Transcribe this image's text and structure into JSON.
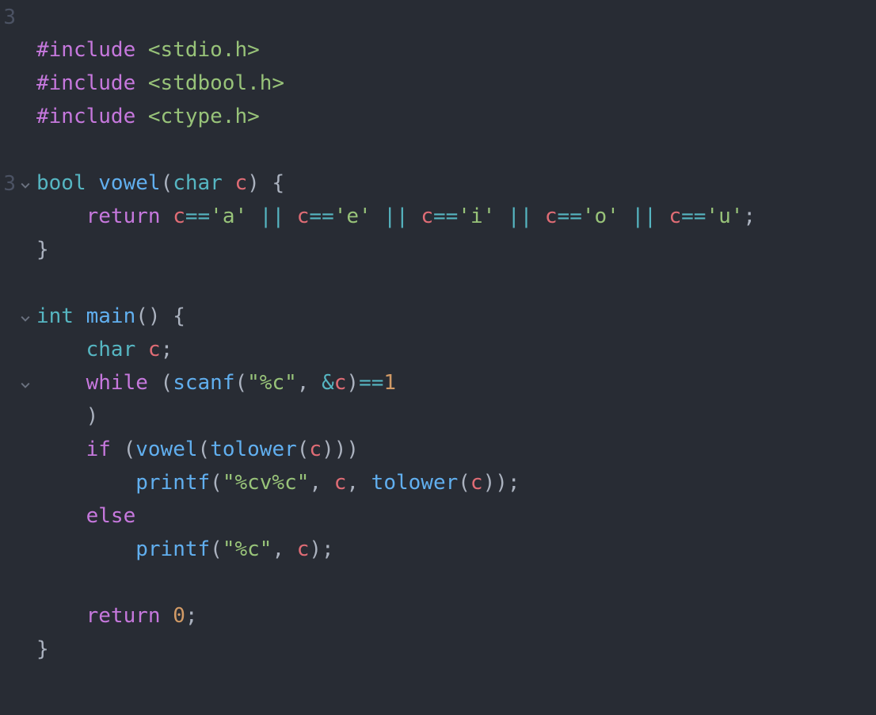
{
  "gutter": {
    "rows": [
      {
        "n": "3",
        "fold": false
      },
      {
        "n": " ",
        "fold": false
      },
      {
        "n": " ",
        "fold": false
      },
      {
        "n": " ",
        "fold": false
      },
      {
        "n": " ",
        "fold": false
      },
      {
        "n": "3",
        "fold": true
      },
      {
        "n": " ",
        "fold": false
      },
      {
        "n": " ",
        "fold": false
      },
      {
        "n": " ",
        "fold": false
      },
      {
        "n": " ",
        "fold": true
      },
      {
        "n": " ",
        "fold": false
      },
      {
        "n": " ",
        "fold": true
      },
      {
        "n": " ",
        "fold": false
      },
      {
        "n": " ",
        "fold": false
      },
      {
        "n": " ",
        "fold": false
      },
      {
        "n": " ",
        "fold": false
      },
      {
        "n": " ",
        "fold": false
      },
      {
        "n": " ",
        "fold": false
      },
      {
        "n": " ",
        "fold": false
      },
      {
        "n": " ",
        "fold": false
      },
      {
        "n": " ",
        "fold": false
      }
    ]
  },
  "code": {
    "lines": [
      [],
      [
        {
          "t": "#include ",
          "c": "pp"
        },
        {
          "t": "<stdio.h>",
          "c": "inc"
        }
      ],
      [
        {
          "t": "#include ",
          "c": "pp"
        },
        {
          "t": "<stdbool.h>",
          "c": "inc"
        }
      ],
      [
        {
          "t": "#include ",
          "c": "pp"
        },
        {
          "t": "<ctype.h>",
          "c": "inc"
        }
      ],
      [],
      [
        {
          "t": "bool",
          "c": "ty2"
        },
        {
          "t": " ",
          "c": "pun"
        },
        {
          "t": "vowel",
          "c": "fn"
        },
        {
          "t": "(",
          "c": "pun"
        },
        {
          "t": "char",
          "c": "ty2"
        },
        {
          "t": " ",
          "c": "pun"
        },
        {
          "t": "c",
          "c": "var2"
        },
        {
          "t": ") {",
          "c": "pun"
        }
      ],
      [
        {
          "t": "    ",
          "c": "pun"
        },
        {
          "t": "return",
          "c": "kw"
        },
        {
          "t": " ",
          "c": "pun"
        },
        {
          "t": "c",
          "c": "var2"
        },
        {
          "t": "==",
          "c": "op"
        },
        {
          "t": "'a'",
          "c": "str"
        },
        {
          "t": " ",
          "c": "pun"
        },
        {
          "t": "||",
          "c": "op"
        },
        {
          "t": " ",
          "c": "pun"
        },
        {
          "t": "c",
          "c": "var2"
        },
        {
          "t": "==",
          "c": "op"
        },
        {
          "t": "'e'",
          "c": "str"
        },
        {
          "t": " ",
          "c": "pun"
        },
        {
          "t": "||",
          "c": "op"
        },
        {
          "t": " ",
          "c": "pun"
        },
        {
          "t": "c",
          "c": "var2"
        },
        {
          "t": "==",
          "c": "op"
        },
        {
          "t": "'i'",
          "c": "str"
        },
        {
          "t": " ",
          "c": "pun"
        },
        {
          "t": "||",
          "c": "op"
        },
        {
          "t": " ",
          "c": "pun"
        },
        {
          "t": "c",
          "c": "var2"
        },
        {
          "t": "==",
          "c": "op"
        },
        {
          "t": "'o'",
          "c": "str"
        },
        {
          "t": " ",
          "c": "pun"
        },
        {
          "t": "||",
          "c": "op"
        },
        {
          "t": " ",
          "c": "pun"
        },
        {
          "t": "c",
          "c": "var2"
        },
        {
          "t": "==",
          "c": "op"
        },
        {
          "t": "'u'",
          "c": "str"
        },
        {
          "t": ";",
          "c": "pun"
        }
      ],
      [
        {
          "t": "}",
          "c": "pun"
        }
      ],
      [],
      [
        {
          "t": "int",
          "c": "ty2"
        },
        {
          "t": " ",
          "c": "pun"
        },
        {
          "t": "main",
          "c": "fn"
        },
        {
          "t": "() {",
          "c": "pun"
        }
      ],
      [
        {
          "t": "    ",
          "c": "pun"
        },
        {
          "t": "char",
          "c": "ty2"
        },
        {
          "t": " ",
          "c": "pun"
        },
        {
          "t": "c",
          "c": "var2"
        },
        {
          "t": ";",
          "c": "pun"
        }
      ],
      [
        {
          "t": "    ",
          "c": "pun"
        },
        {
          "t": "while",
          "c": "kw"
        },
        {
          "t": " (",
          "c": "pun"
        },
        {
          "t": "scanf",
          "c": "fn"
        },
        {
          "t": "(",
          "c": "pun"
        },
        {
          "t": "\"%c\"",
          "c": "str"
        },
        {
          "t": ", ",
          "c": "pun"
        },
        {
          "t": "&",
          "c": "op"
        },
        {
          "t": "c",
          "c": "var2"
        },
        {
          "t": ")",
          "c": "pun"
        },
        {
          "t": "==",
          "c": "op"
        },
        {
          "t": "1",
          "c": "num"
        }
      ],
      [
        {
          "t": "    )",
          "c": "pun"
        }
      ],
      [
        {
          "t": "    ",
          "c": "pun"
        },
        {
          "t": "if",
          "c": "kw"
        },
        {
          "t": " (",
          "c": "pun"
        },
        {
          "t": "vowel",
          "c": "fn"
        },
        {
          "t": "(",
          "c": "pun"
        },
        {
          "t": "tolower",
          "c": "fn"
        },
        {
          "t": "(",
          "c": "pun"
        },
        {
          "t": "c",
          "c": "var2"
        },
        {
          "t": ")))",
          "c": "pun"
        }
      ],
      [
        {
          "t": "        ",
          "c": "pun"
        },
        {
          "t": "printf",
          "c": "fn"
        },
        {
          "t": "(",
          "c": "pun"
        },
        {
          "t": "\"%cv%c\"",
          "c": "str"
        },
        {
          "t": ", ",
          "c": "pun"
        },
        {
          "t": "c",
          "c": "var2"
        },
        {
          "t": ", ",
          "c": "pun"
        },
        {
          "t": "tolower",
          "c": "fn"
        },
        {
          "t": "(",
          "c": "pun"
        },
        {
          "t": "c",
          "c": "var2"
        },
        {
          "t": "));",
          "c": "pun"
        }
      ],
      [
        {
          "t": "    ",
          "c": "pun"
        },
        {
          "t": "else",
          "c": "kw"
        }
      ],
      [
        {
          "t": "        ",
          "c": "pun"
        },
        {
          "t": "printf",
          "c": "fn"
        },
        {
          "t": "(",
          "c": "pun"
        },
        {
          "t": "\"%c\"",
          "c": "str"
        },
        {
          "t": ", ",
          "c": "pun"
        },
        {
          "t": "c",
          "c": "var2"
        },
        {
          "t": ");",
          "c": "pun"
        }
      ],
      [],
      [
        {
          "t": "    ",
          "c": "pun"
        },
        {
          "t": "return",
          "c": "kw"
        },
        {
          "t": " ",
          "c": "pun"
        },
        {
          "t": "0",
          "c": "num"
        },
        {
          "t": ";",
          "c": "pun"
        }
      ],
      [
        {
          "t": "}",
          "c": "pun"
        }
      ],
      []
    ]
  }
}
